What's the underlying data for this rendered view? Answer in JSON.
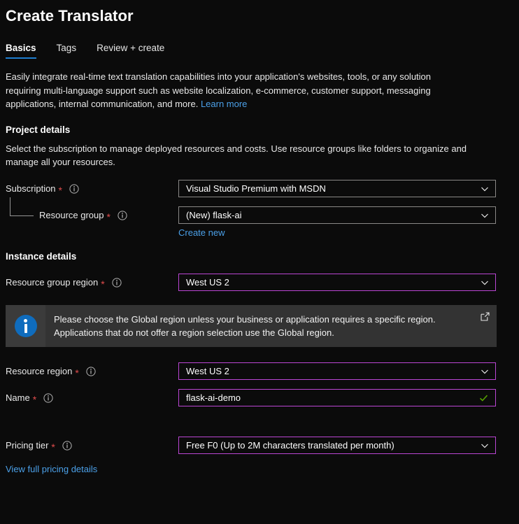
{
  "header": {
    "title": "Create Translator"
  },
  "tabs": [
    {
      "label": "Basics",
      "active": true
    },
    {
      "label": "Tags",
      "active": false
    },
    {
      "label": "Review + create",
      "active": false
    }
  ],
  "intro": {
    "text": "Easily integrate real-time text translation capabilities into your application's websites, tools, or any solution requiring multi-language support such as website localization, e-commerce, customer support, messaging applications, internal communication, and more.",
    "link_label": "Learn more"
  },
  "project_details": {
    "heading": "Project details",
    "description": "Select the subscription to manage deployed resources and costs. Use resource groups like folders to organize and manage all your resources.",
    "subscription": {
      "label": "Subscription",
      "required": "*",
      "value": "Visual Studio Premium with MSDN"
    },
    "resource_group": {
      "label": "Resource group",
      "required": "*",
      "value": "(New) flask-ai",
      "create_new_label": "Create new"
    }
  },
  "instance_details": {
    "heading": "Instance details",
    "resource_group_region": {
      "label": "Resource group region",
      "required": "*",
      "value": "West US 2"
    },
    "resource_region": {
      "label": "Resource region",
      "required": "*",
      "value": "West US 2"
    },
    "name": {
      "label": "Name",
      "required": "*",
      "value": "flask-ai-demo"
    },
    "pricing_tier": {
      "label": "Pricing tier",
      "required": "*",
      "value": "Free F0 (Up to 2M characters translated per month)",
      "pricing_link_label": "View full pricing details"
    }
  },
  "banner": {
    "text": "Please choose the Global region unless your business or application requires a specific region. Applications that do not offer a region selection use the Global region."
  },
  "colors": {
    "background": "#0b0b0b",
    "accent_link": "#4ba0e8",
    "tab_underline": "#1f7ed0",
    "focus_border": "#bb46d4",
    "required_asterisk": "#e04c4c",
    "validation_ok": "#57a300",
    "info_icon_blue": "#0f6cbd",
    "banner_background": "#333333"
  }
}
